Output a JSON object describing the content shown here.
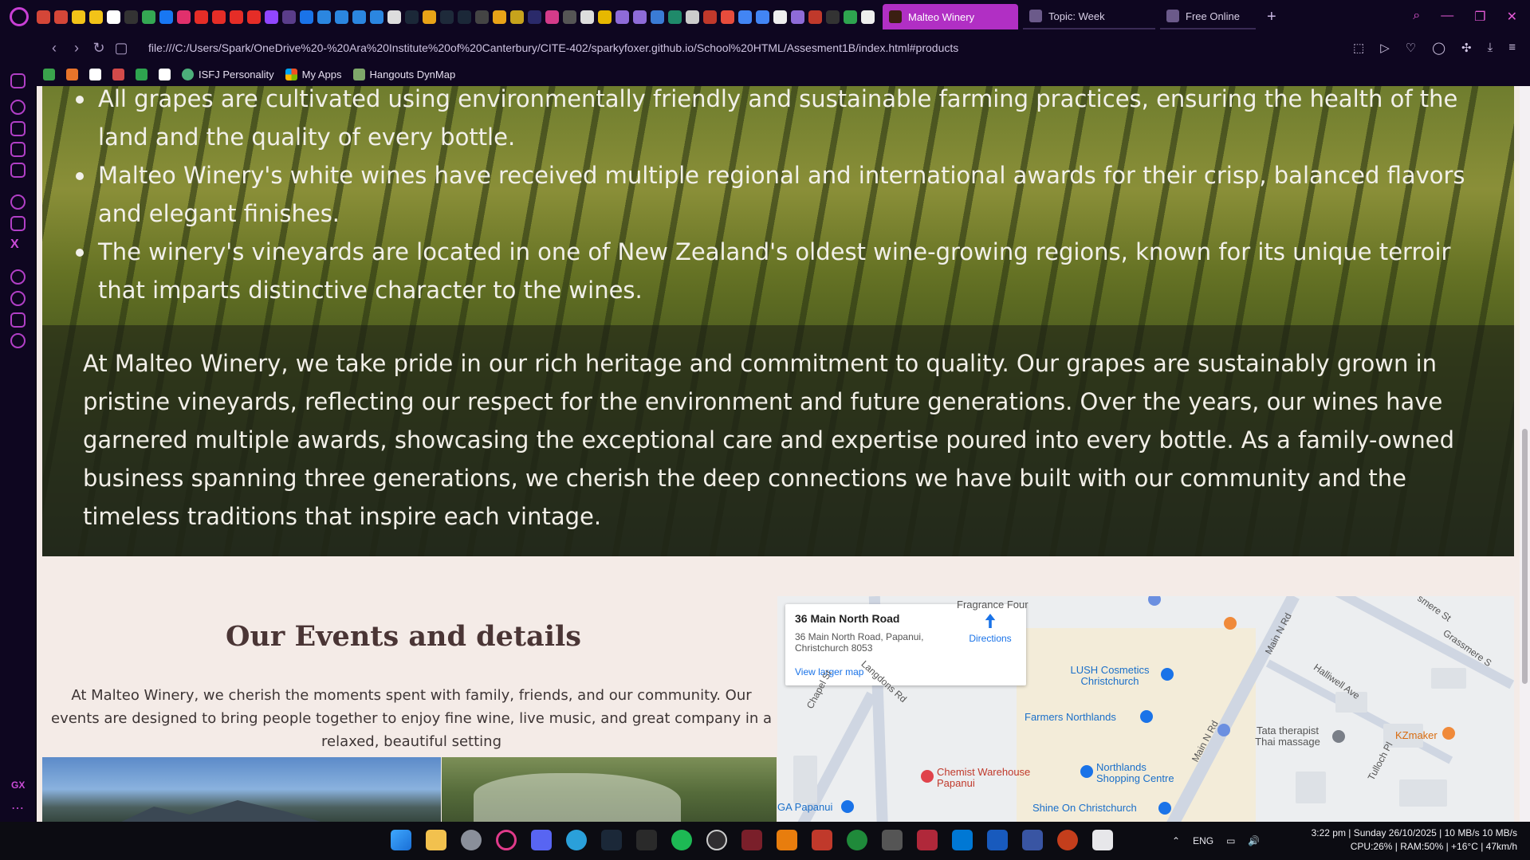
{
  "browser": {
    "tabs": [
      {
        "label": "Malteo Winery",
        "active": true
      },
      {
        "label": "Topic: Week",
        "active": false
      },
      {
        "label": "Free Online",
        "active": false
      }
    ],
    "new_tab": "+",
    "url": "file:///C:/Users/Spark/OneDrive%20-%20Ara%20Institute%20of%20Canterbury/CITE-402/sparkyfoxer.github.io/School%20HTML/Assesment1B/index.html#products",
    "bookmarks": [
      {
        "label": "",
        "icon": "leaf-bookmark-icon",
        "color": "#3aa34c"
      },
      {
        "label": "",
        "icon": "fox-bookmark-icon",
        "color": "#e8742a"
      },
      {
        "label": "",
        "icon": "r-bookmark-icon",
        "color": "#ffffff"
      },
      {
        "label": "",
        "icon": "badge-bookmark-icon",
        "color": "#d34a4a"
      },
      {
        "label": "",
        "icon": "plus-bookmark-icon",
        "color": "#2ea44f"
      },
      {
        "label": "",
        "icon": "play-bookmark-icon",
        "color": "#ffffff"
      },
      {
        "label": "ISFJ Personality",
        "icon": "personality-icon",
        "color": "#4caf7a"
      },
      {
        "label": "My Apps",
        "icon": "apps-grid-icon",
        "color": "#f2b01e"
      },
      {
        "label": "Hangouts DynMap",
        "icon": "map-bookmark-icon",
        "color": "#7ea86a"
      }
    ]
  },
  "page": {
    "facts": [
      "All grapes are cultivated using environmentally friendly and sustainable farming practices, ensuring the health of the land and the quality of every bottle.",
      "Malteo Winery's white wines have received multiple regional and international awards for their crisp, balanced flavors and elegant finishes.",
      "The winery's vineyards are located in one of New Zealand's oldest wine-growing regions, known for its unique terroir that imparts distinctive character to the wines."
    ],
    "about": "At Malteo Winery, we take pride in our rich heritage and commitment to quality. Our grapes are sustainably grown in pristine vineyards, reflecting our respect for the environment and future generations. Over the years, our wines have garnered multiple awards, showcasing the exceptional care and expertise poured into every bottle. As a family-owned business spanning three generations, we cherish the deep connections we have built with our community and the timeless traditions that inspire each vintage.",
    "events_title": "Our Events and details",
    "events_text": "At Malteo Winery, we cherish the moments spent with family, friends, and our community. Our events are designed to bring people together to enjoy fine wine, live music, and great company in a relaxed, beautiful setting"
  },
  "map": {
    "place_title": "36 Main North Road",
    "place_address": "36 Main North Road, Papanui, Christchurch 8053",
    "directions": "Directions",
    "larger_map": "View larger map",
    "pois": {
      "fragrance": "Fragrance Four",
      "lush": "LUSH Cosmetics Christchurch",
      "farmers": "Farmers Northlands",
      "chemist": "Chemist Warehouse Papanui",
      "northlands": "Northlands Shopping Centre",
      "shine": "Shine On Christchurch",
      "ga": "GA Papanui",
      "tata": "Tata therapist Thai massage",
      "kzmaker": "KZmaker"
    },
    "streets": {
      "chapel": "Chapel St",
      "langdons": "Langdons Rd",
      "main_n_rd_top": "Main N Rd",
      "main_n_rd_bottom": "Main N Rd",
      "halliwell": "Halliwell Ave",
      "grassmere": "Grassmere S",
      "rosmere": "smere St",
      "tulloch": "Tulloch Pl"
    }
  },
  "taskbar": {
    "language": "ENG",
    "time_line": "3:22 pm | Sunday 26/10/2025 | 10 MB/s 10 MB/s",
    "stats_line": "CPU:26% | RAM:50% | +16°C | 47km/h"
  },
  "colors": {
    "accent": "#b12fc4",
    "page_bg": "#f4ebe7",
    "heading": "#4a3535",
    "link": "#1a73e8"
  }
}
